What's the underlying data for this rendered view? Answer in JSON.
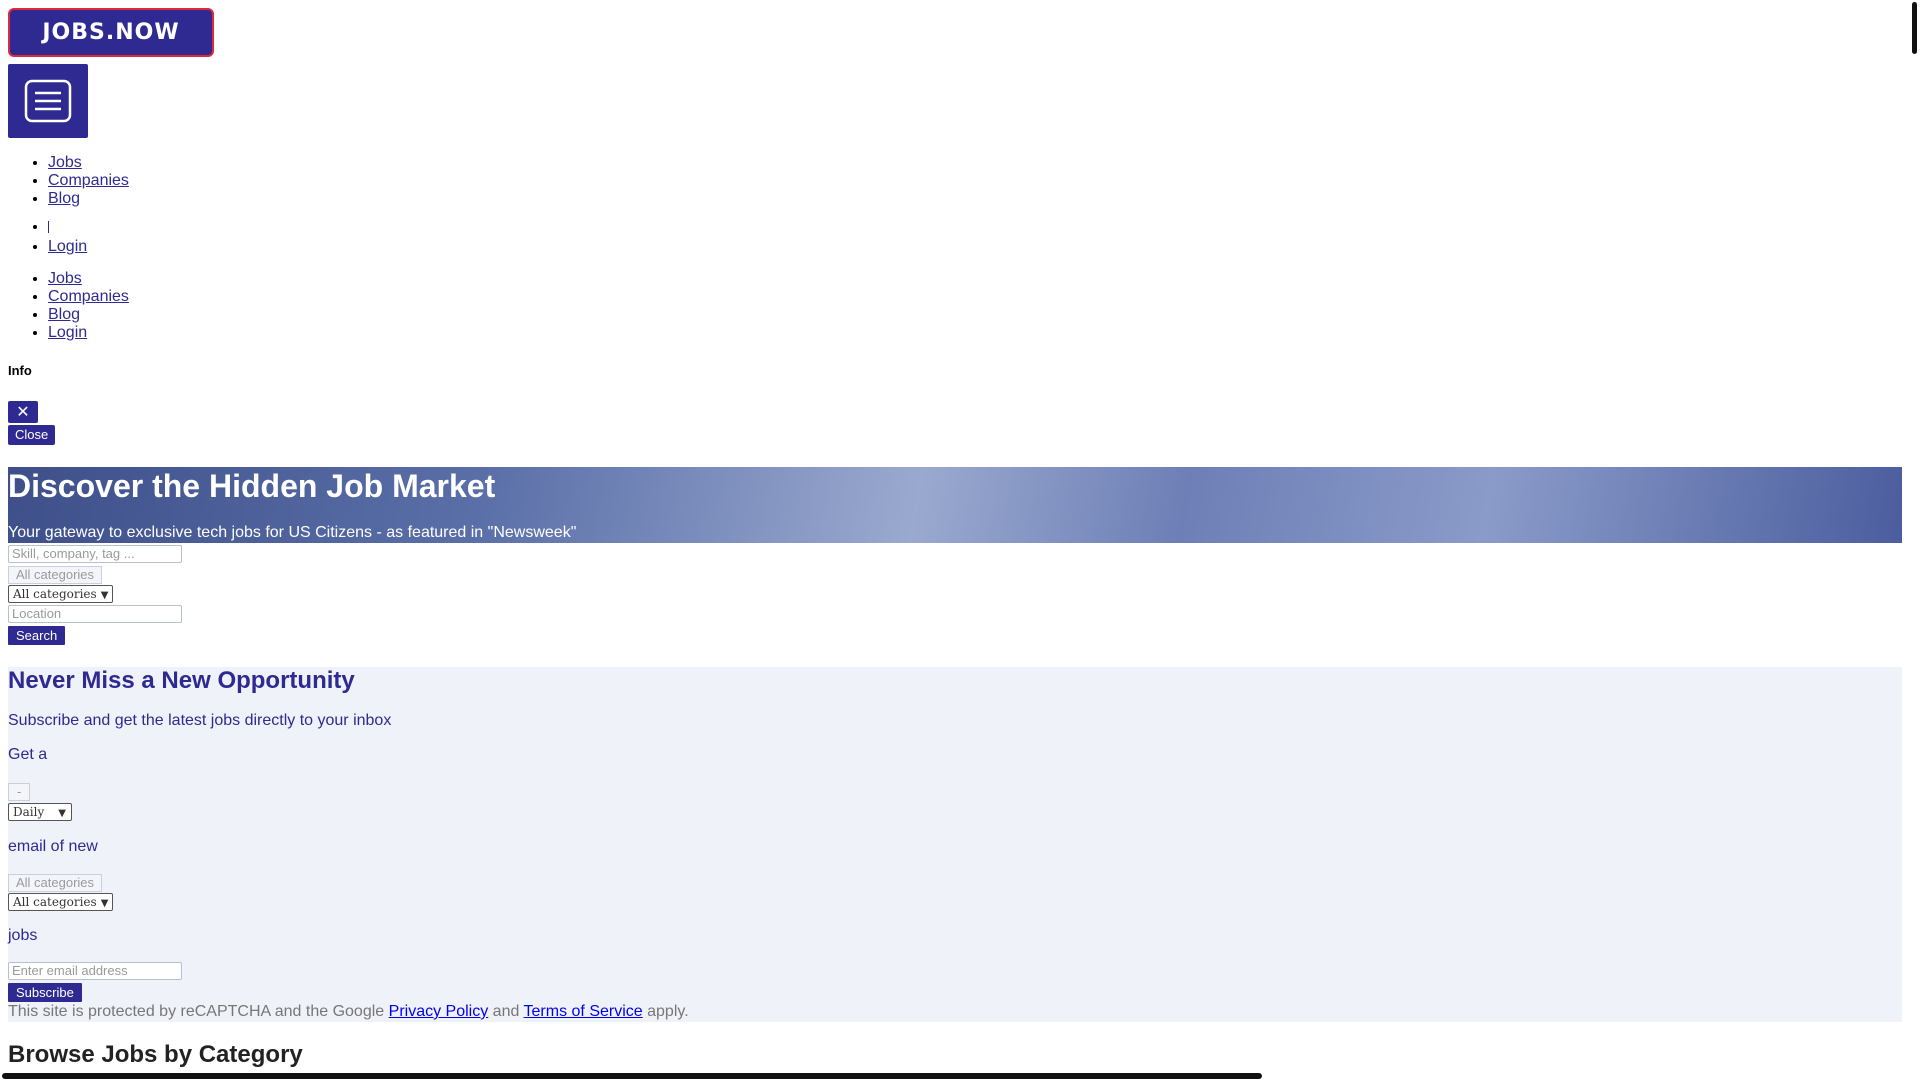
{
  "brand": {
    "logo_text": "JOBS.NOW"
  },
  "nav_primary": [
    "Jobs",
    "Companies",
    "Blog",
    "Login"
  ],
  "nav_mobile": [
    "Jobs",
    "Companies",
    "Blog",
    "Login"
  ],
  "info": {
    "title": "Info",
    "close_label": "Close",
    "x_label": "✕"
  },
  "hero": {
    "title": "Discover the Hidden Job Market",
    "subtitle": "Your gateway to exclusive tech jobs for US Citizens - as featured in \"Newsweek\""
  },
  "search": {
    "keyword_placeholder": "Skill, company, tag ...",
    "category_pill": "All categories",
    "category_select": "All categories",
    "location_placeholder": "Location",
    "button": "Search"
  },
  "subscribe": {
    "title": "Never Miss a New Opportunity",
    "subtitle": "Subscribe and get the latest jobs directly to your inbox",
    "get_a": "Get a",
    "freq_pill": "-",
    "freq_select": "Daily",
    "email_of_new": "email of new",
    "category_pill": "All categories",
    "category_select": "All categories",
    "jobs": "jobs",
    "email_placeholder": "Enter email address",
    "button": "Subscribe",
    "recaptcha_prefix": "This site is protected by reCAPTCHA and the Google",
    "privacy": "Privacy Policy",
    "and": "and",
    "terms": "Terms of Service",
    "apply": "apply."
  },
  "browse": {
    "title": "Browse Jobs by Category"
  }
}
